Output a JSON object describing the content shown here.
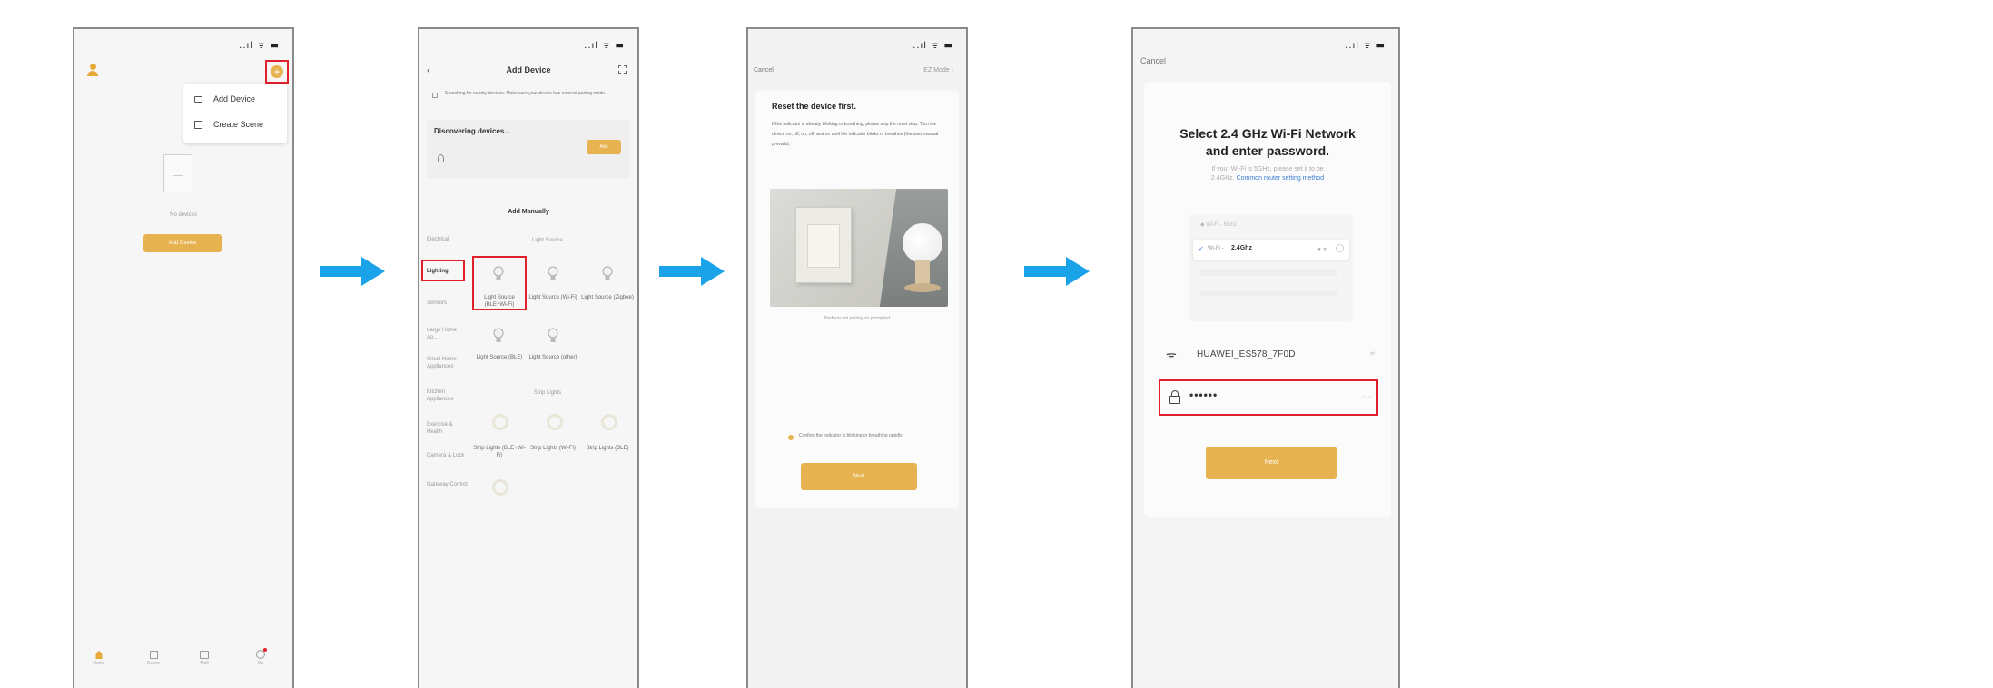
{
  "screen1": {
    "menu": {
      "add_device": "Add Device",
      "create_scene": "Create Scene"
    },
    "empty_text": "No devices",
    "add_button": "Add Device",
    "tabs": [
      "Home",
      "Scene",
      "Mall",
      "Me"
    ]
  },
  "screen2": {
    "title": "Add Device",
    "notice": "Searching for nearby devices. Make sure your device has entered pairing mode.",
    "discovering": "Discovering devices...",
    "add_button": "Add",
    "add_manually": "Add Manually",
    "categories": [
      "Electrical",
      "Lighting",
      "Sensors",
      "Large Home Ap...",
      "Small Home Appliances",
      "Kitchen Appliances",
      "Exercise & Health",
      "Camera & Lock",
      "Gateway Control"
    ],
    "section_light_source": "Light Source",
    "section_strip_lights": "Strip Lights",
    "devices": [
      {
        "label": "Light Source (BLE+Wi-Fi)"
      },
      {
        "label": "Light Source (Wi-Fi)"
      },
      {
        "label": "Light Source (Zigbee)"
      },
      {
        "label": "Light Source (BLE)"
      },
      {
        "label": "Light Source (other)"
      },
      {
        "label": "Strip Lights (BLE+Wi-Fi)"
      },
      {
        "label": "Strip Lights (Wi-Fi)"
      },
      {
        "label": "Strip Lights (BLE)"
      }
    ]
  },
  "screen3": {
    "cancel": "Cancel",
    "mode": "EZ Mode",
    "title": "Reset the device first.",
    "body": "If the indicator is already blinking or breathing, please skip the reset step. Turn the device on, off, on, off, and on until the indicator blinks or breathes (the user manual prevails).",
    "link": "Perform net pairing as prompted",
    "confirm": "Confirm the indicator is blinking or breathing rapidly",
    "next": "Next"
  },
  "screen4": {
    "cancel": "Cancel",
    "title_line1": "Select 2.4 GHz Wi-Fi Network",
    "title_line2": "and enter password.",
    "hint_line1": "If your Wi-Fi is 5GHz, please set it to be",
    "hint_line2": "2.4GHz.",
    "hint_link": "Common router setting method",
    "net_5g": "Wi-Fi - 5Ghz",
    "net_24g_prefix": "Wi-Fi -",
    "net_24g_band": "2.4Ghz",
    "ssid": "HUAWEI_ES578_7F0D",
    "password": "••••••",
    "next": "Next"
  },
  "status": {
    "icons": "..ıl ᯤ ▬"
  }
}
